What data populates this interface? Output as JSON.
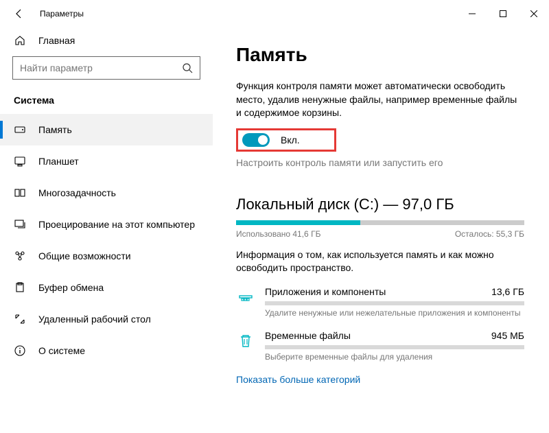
{
  "window": {
    "title": "Параметры"
  },
  "sidebar": {
    "home": "Главная",
    "search_placeholder": "Найти параметр",
    "section": "Система",
    "items": [
      {
        "label": "Память"
      },
      {
        "label": "Планшет"
      },
      {
        "label": "Многозадачность"
      },
      {
        "label": "Проецирование на этот компьютер"
      },
      {
        "label": "Общие возможности"
      },
      {
        "label": "Буфер обмена"
      },
      {
        "label": "Удаленный рабочий стол"
      },
      {
        "label": "О системе"
      }
    ]
  },
  "main": {
    "title": "Память",
    "description": "Функция контроля памяти может автоматически освободить место, удалив ненужные файлы, например временные файлы и содержимое корзины.",
    "toggle_label": "Вкл.",
    "configure": "Настроить контроль памяти или запустить его",
    "disk": {
      "title": "Локальный диск (C:) — 97,0 ГБ",
      "used_pct": 43,
      "used": "Использовано 41,6 ГБ",
      "free": "Осталось: 55,3 ГБ",
      "desc": "Информация о том, как используется память и как можно освободить пространство."
    },
    "categories": [
      {
        "name": "Приложения и компоненты",
        "size": "13,6 ГБ",
        "hint": "Удалите ненужные или нежелательные приложения и компоненты"
      },
      {
        "name": "Временные файлы",
        "size": "945 МБ",
        "hint": "Выберите временные файлы для удаления"
      }
    ],
    "show_more": "Показать больше категорий"
  },
  "colors": {
    "accent": "#0078d4",
    "teal": "#00b7c3"
  }
}
